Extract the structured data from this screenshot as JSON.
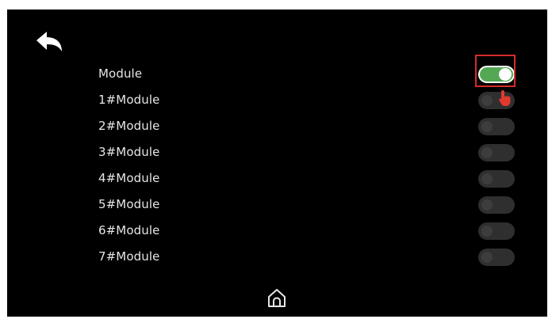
{
  "icons": {
    "back": "back-arrow-icon",
    "home": "home-icon",
    "pointer": "hand-pointer-icon"
  },
  "colors": {
    "screen_background": "#000000",
    "label_text": "#e6e6e6",
    "toggle_on": "#54a853",
    "toggle_off": "#2f2f2f",
    "highlight": "#d62b2b"
  },
  "modules": [
    {
      "label": "Module",
      "enabled": true
    },
    {
      "label": "1#Module",
      "enabled": false
    },
    {
      "label": "2#Module",
      "enabled": false
    },
    {
      "label": "3#Module",
      "enabled": false
    },
    {
      "label": "4#Module",
      "enabled": false
    },
    {
      "label": "5#Module",
      "enabled": false
    },
    {
      "label": "6#Module",
      "enabled": false
    },
    {
      "label": "7#Module",
      "enabled": false
    }
  ]
}
